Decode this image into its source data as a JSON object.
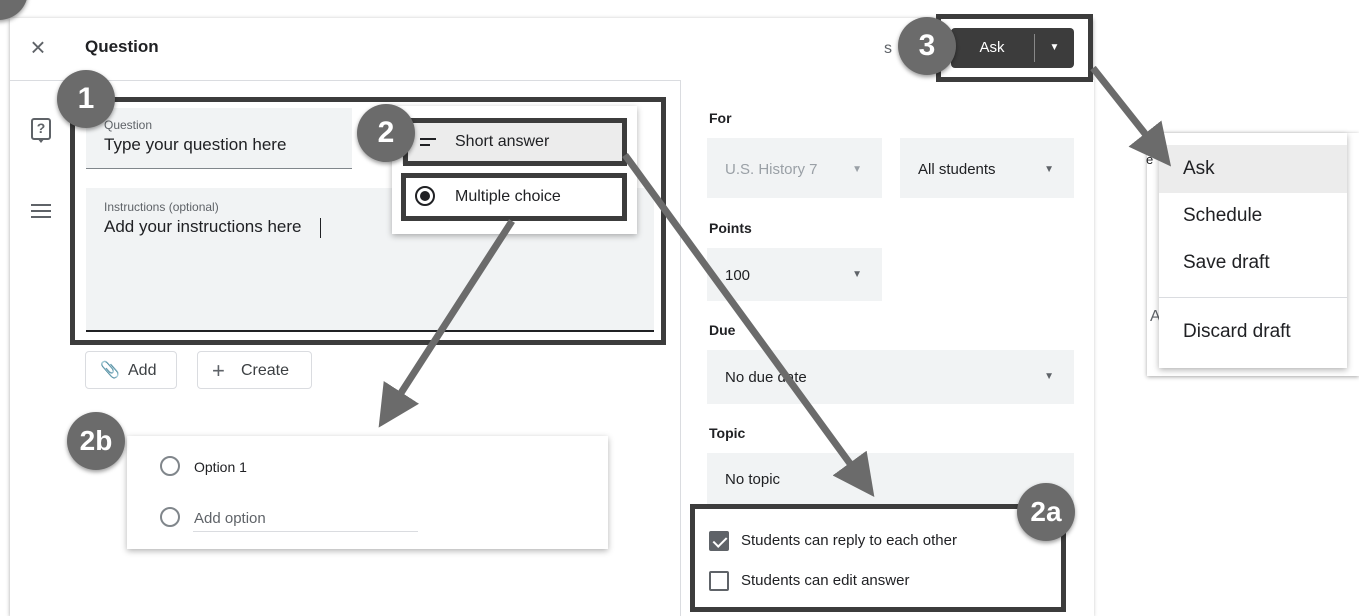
{
  "header": {
    "close_glyph": "×",
    "title": "Question",
    "cutoff_char": "s",
    "ask_label": "Ask",
    "ask_dropdown_glyph": "▼"
  },
  "left_icons": [
    "question-mark-icon",
    "notes-icon"
  ],
  "question": {
    "label": "Question",
    "value": "Type your question here"
  },
  "instructions": {
    "label": "Instructions (optional)",
    "value": "Add your instructions here"
  },
  "type_menu": {
    "short_answer": "Short answer",
    "multiple_choice": "Multiple choice",
    "selected": "Multiple choice"
  },
  "attach": {
    "add_label": "Add",
    "add_icon": "paperclip-icon",
    "create_label": "Create",
    "create_icon": "plus-icon"
  },
  "options": {
    "option1": "Option 1",
    "add_option": "Add option"
  },
  "settings": {
    "for_label": "For",
    "class_value": "U.S. History 7",
    "students_value": "All students",
    "points_label": "Points",
    "points_value": "100",
    "due_label": "Due",
    "due_value": "No due date",
    "topic_label": "Topic",
    "topic_value": "No topic",
    "reply_label": "Students can reply to each other",
    "reply_checked": true,
    "edit_label": "Students can edit answer",
    "edit_checked": false
  },
  "ask_menu": {
    "items": [
      "Ask",
      "Schedule",
      "Save draft",
      "Discard draft"
    ],
    "highlighted": "Ask",
    "background_partial_e": "e",
    "background_partial_a": "A"
  },
  "callouts": {
    "one": "1",
    "two": "2",
    "three": "3",
    "two_a": "2a",
    "two_b": "2b"
  },
  "colors": {
    "accent_dark": "#3c3c3c",
    "badge": "#6b6b6b",
    "field_bg": "#f1f3f4",
    "menu_highlight": "#ececec"
  }
}
